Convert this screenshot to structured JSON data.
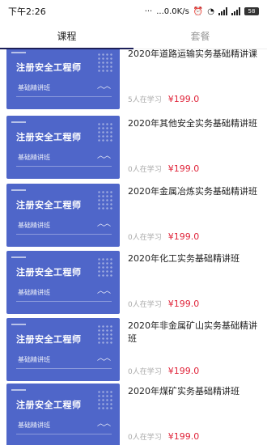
{
  "status_bar": {
    "time": "下午2:26",
    "network_speed": "...0.0K/s",
    "battery": "58"
  },
  "tabs": [
    {
      "label": "课程",
      "active": true
    },
    {
      "label": "套餐",
      "active": false
    }
  ],
  "thumbnail": {
    "title": "注册安全工程师",
    "subtitle": "基础精讲班"
  },
  "courses": [
    {
      "title": "2020年道路运输实务基础精讲课",
      "learners": "5人在学习",
      "price": "¥199.0"
    },
    {
      "title": "2020年其他安全实务基础精讲班",
      "learners": "0人在学习",
      "price": "¥199.0"
    },
    {
      "title": "2020年金属冶炼实务基础精讲班",
      "learners": "0人在学习",
      "price": "¥199.0"
    },
    {
      "title": "2020年化工实务基础精讲班",
      "learners": "0人在学习",
      "price": "¥199.0"
    },
    {
      "title": "2020年非金属矿山实务基础精讲班",
      "learners": "0人在学习",
      "price": "¥199.0"
    },
    {
      "title": "2020年煤矿实务基础精讲班",
      "learners": "0人在学习",
      "price": "¥199.0"
    }
  ],
  "colors": {
    "accent": "#1c1f58",
    "thumb_bg": "#4f66c9",
    "price": "#e0243a"
  }
}
